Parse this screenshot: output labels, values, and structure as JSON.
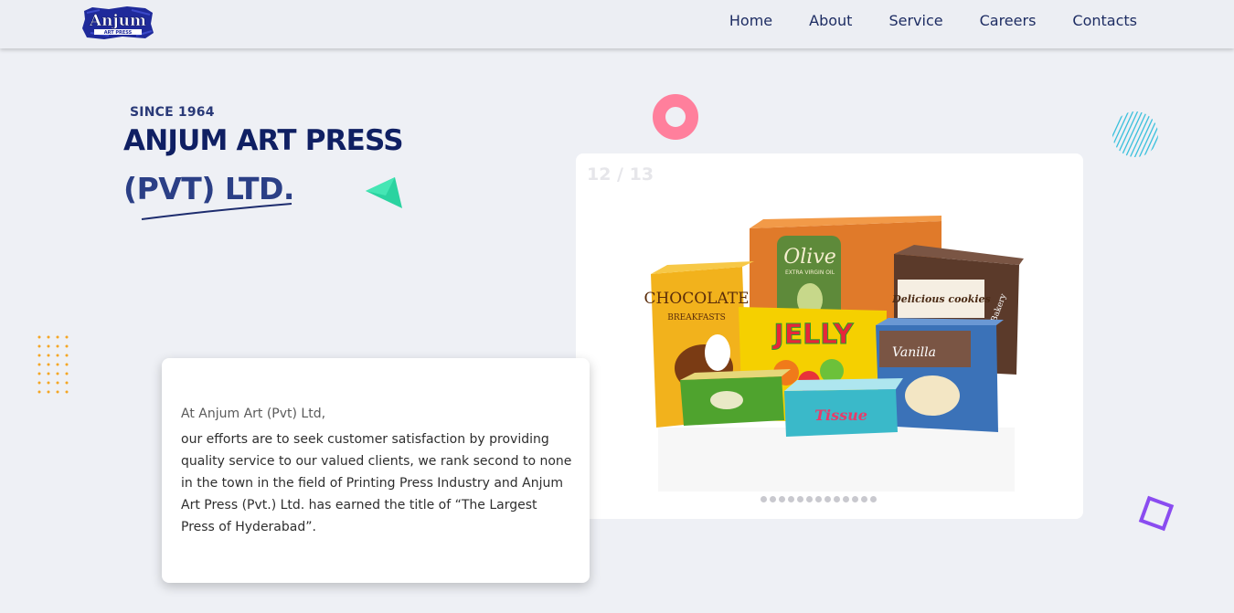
{
  "brand": {
    "logo_text": "Anjum",
    "logo_subtext": "ART PRESS",
    "colors": {
      "navy": "#0f1f63",
      "accent_pink": "#ff7f9c",
      "accent_green": "#2bd3a0",
      "accent_orange": "#f5a623",
      "accent_purple": "#8a4cf0"
    }
  },
  "nav": {
    "items": [
      {
        "label": "Home"
      },
      {
        "label": "About"
      },
      {
        "label": "Service"
      },
      {
        "label": "Careers"
      },
      {
        "label": "Contacts"
      }
    ]
  },
  "hero": {
    "since": "SINCE 1964",
    "title_line1": "ANJUM ART PRESS",
    "title_line2": "(PVT) LTD."
  },
  "slider": {
    "counter": "12 / 13",
    "current_slide": 12,
    "total_slides": 13,
    "products": {
      "chocolate": "CHOCOLATE",
      "chocolate_sub": "BREAKFASTS",
      "olive": "Olive",
      "olive_sub": "EXTRA VIRGIN OIL",
      "cookies": "Delicious cookies",
      "bakery": "Bakery",
      "jelly": "JELLY",
      "vanilla": "Vanilla",
      "tissue": "Tissue"
    }
  },
  "intro": {
    "lead": "At Anjum Art (Pvt) Ltd,",
    "body": "our efforts are to seek customer satisfaction by providing quality service to our valued clients, we rank second to none in the town in the field of Printing Press Industry and Anjum Art Press (Pvt.) Ltd. has earned the title of “The Largest Press of Hyderabad”."
  }
}
